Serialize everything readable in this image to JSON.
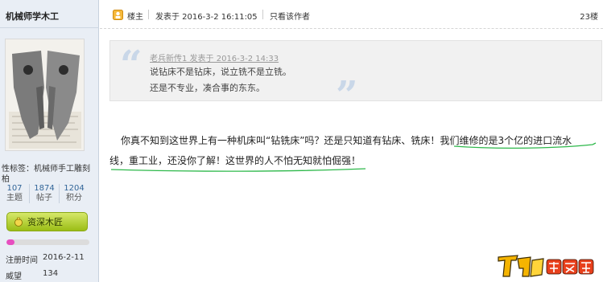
{
  "sidebar": {
    "username": "机械师学木工",
    "tags": "性标签：机械师手工雕刻柏",
    "stats": [
      {
        "value": "107",
        "label": "主题"
      },
      {
        "value": "1874",
        "label": "帖子"
      },
      {
        "value": "1204",
        "label": "积分"
      }
    ],
    "rank_label": "资深木匠",
    "rank_progress": 0.1,
    "register_label": "注册时间",
    "register_value": "2016-2-11",
    "prestige_label": "威望",
    "prestige_value": "134"
  },
  "post_header": {
    "op_label": "楼主",
    "time": "发表于 2016-3-2 16:11:05",
    "author_only": "只看该作者",
    "floor": "23楼"
  },
  "quote": {
    "meta": "老兵新传1 发表于 2016-3-2 14:33",
    "lines": [
      "说钻床不是钻床，说立铣不是立铣。",
      "还是不专业，凑合事的东东。"
    ]
  },
  "post_body": {
    "line1_plain": "你真不知到这世界上有一种机床叫“钻铣床”吗？还是只知道有钻床、铣床！",
    "line1_highlight": "我们维修的是3个亿的进口流水",
    "line2": "线，重工业，还没你了解！这世界的人不怕无知就怕倔强！"
  },
  "colors": {
    "sidebar_bg": "#e9eef5",
    "underline": "#2db84a",
    "rank_button": "#b2cf2a",
    "progress_fill": "#e74ec0"
  }
}
